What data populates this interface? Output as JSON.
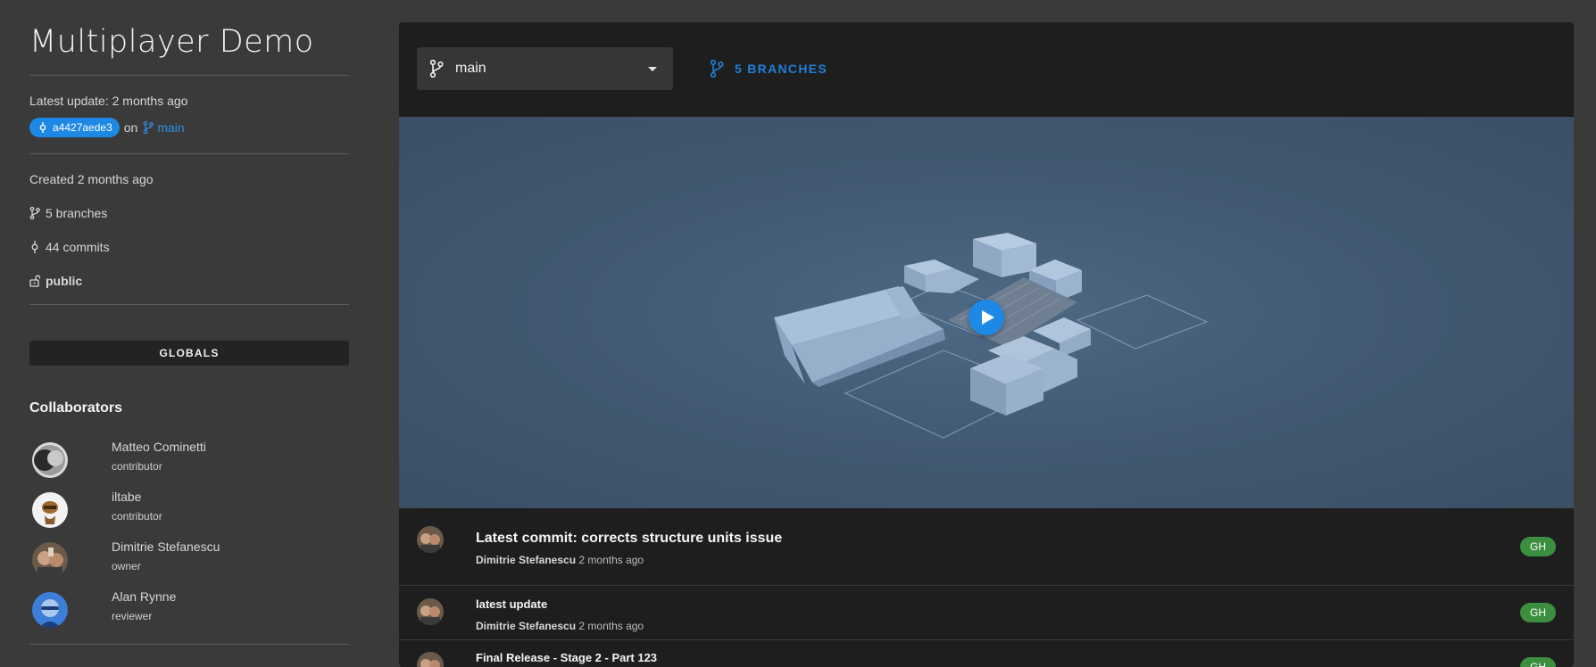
{
  "sidebar": {
    "title": "Multiplayer Demo",
    "latest_update": "Latest update: 2 months ago",
    "commit_hash": "a4427aede3",
    "on_text": "on",
    "branch": "main",
    "created": "Created 2 months ago",
    "branches": "5 branches",
    "commits": "44 commits",
    "visibility": "public",
    "globals_label": "GLOBALS",
    "collaborators_title": "Collaborators",
    "collaborators": [
      {
        "name": "Matteo Cominetti",
        "role": "contributor"
      },
      {
        "name": "iltabe",
        "role": "contributor"
      },
      {
        "name": "Dimitrie Stefanescu",
        "role": "owner"
      },
      {
        "name": "Alan Rynne",
        "role": "reviewer"
      }
    ]
  },
  "main": {
    "branch_select": "main",
    "branches_link": "5 BRANCHES",
    "commits": [
      {
        "message": "Latest commit: corrects structure units issue",
        "author": "Dimitrie Stefanescu",
        "time": "2 months ago",
        "source": "GH"
      },
      {
        "message": "latest update",
        "author": "Dimitrie Stefanescu",
        "time": "2 months ago",
        "source": "GH"
      },
      {
        "message": "Final Release - Stage 2 - Part 123",
        "author": "",
        "time": "",
        "source": "GH"
      }
    ]
  },
  "colors": {
    "accent": "#1e88e5",
    "badge_green": "#3c8f3f",
    "panel": "#1e1e1e",
    "background": "#3a3a3b"
  },
  "icons": [
    "commit-icon",
    "branch-icon",
    "lock-open-icon",
    "chevron-down-icon",
    "play-icon"
  ]
}
